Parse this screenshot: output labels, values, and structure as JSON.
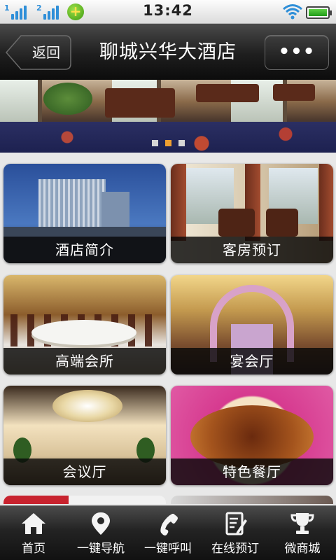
{
  "status_bar": {
    "signal_1_label": "1",
    "signal_2_label": "2",
    "time": "13:42"
  },
  "header": {
    "back_label": "返回",
    "title": "聊城兴华大酒店",
    "more_label": "•••"
  },
  "banner": {
    "dots": 3,
    "active_dot": 2
  },
  "tiles": [
    {
      "label": "酒店简介",
      "image": "hotel-building"
    },
    {
      "label": "客房预订",
      "image": "guest-room"
    },
    {
      "label": "高端会所",
      "image": "dining-club"
    },
    {
      "label": "宴会厅",
      "image": "banquet-hall"
    },
    {
      "label": "会议厅",
      "image": "meeting-hall"
    },
    {
      "label": "特色餐厅",
      "image": "signature-dish"
    }
  ],
  "bottom_nav": [
    {
      "label": "首页",
      "icon": "home-icon"
    },
    {
      "label": "一键导航",
      "icon": "location-pin-icon"
    },
    {
      "label": "一键呼叫",
      "icon": "phone-icon"
    },
    {
      "label": "在线预订",
      "icon": "edit-note-icon"
    },
    {
      "label": "微商城",
      "icon": "trophy-icon"
    }
  ],
  "colors": {
    "accent_dot": "#f0a030",
    "nav_background": "#1e1e1e",
    "signal_blue": "#2f8fd8"
  }
}
